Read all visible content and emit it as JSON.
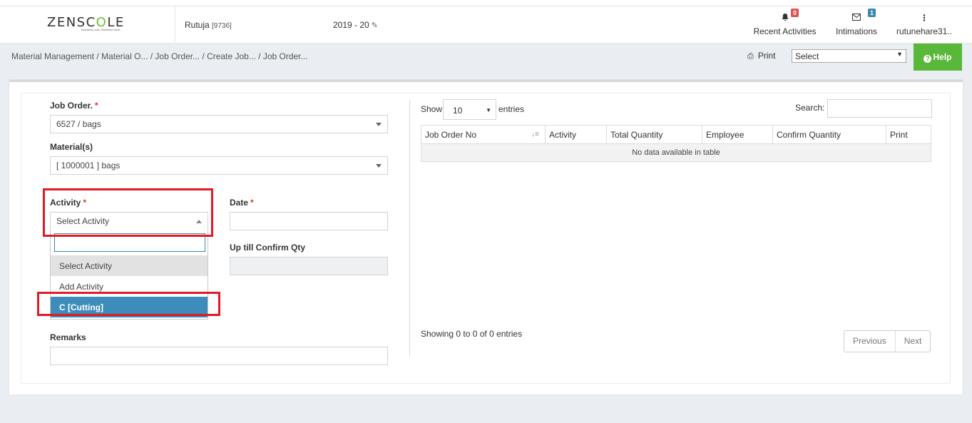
{
  "header": {
    "logo_left": "ZENSC",
    "logo_mid": "O",
    "logo_right": "LE",
    "tagline": "Business Less. Business More.",
    "user_name": "Rutuja",
    "user_code": "[9736]",
    "year": "2019 - 20",
    "recent_activities_label": "Recent Activities",
    "recent_activities_count": "0",
    "intimations_label": "Intimations",
    "intimations_count": "1",
    "account_label": "rutunehare31.."
  },
  "breadcrumb": {
    "root": "Material Management",
    "trail": " / Material O... / Job Order... / Create Job... / Job Order..."
  },
  "toolbar": {
    "print_label": "Print",
    "select_value": "Select",
    "help_label": "Help"
  },
  "form": {
    "job_order_label": "Job Order.",
    "job_order_value": "6527 / bags",
    "materials_label": "Material(s)",
    "materials_value": "[ 1000001 ] bags",
    "activity_label": "Activity",
    "activity_value": "Select Activity",
    "date_label": "Date",
    "confirm_qty_label": "Up till Confirm Qty",
    "remarks_label": "Remarks",
    "required_mark": "*"
  },
  "activity_dropdown": {
    "options": [
      "Select Activity",
      "Add Activity",
      "C [Cutting]"
    ]
  },
  "table": {
    "show_label": "Show",
    "length_value": "10",
    "entries_label": "entries",
    "search_label": "Search:",
    "columns": [
      "Job Order No",
      "Activity",
      "Total Quantity",
      "Employee",
      "Confirm Quantity",
      "Print"
    ],
    "empty_text": "No data available in table",
    "info_text": "Showing 0 to 0 of 0 entries",
    "prev_label": "Previous",
    "next_label": "Next"
  }
}
